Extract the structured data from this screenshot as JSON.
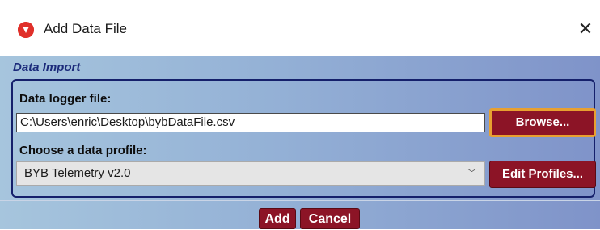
{
  "window": {
    "title": "Add Data File",
    "icon": "app-logo-icon",
    "close_glyph": "✕"
  },
  "section": {
    "title": "Data Import"
  },
  "logger": {
    "label": "Data logger file:",
    "path": "C:\\Users\\enric\\Desktop\\bybDataFile.csv",
    "browse_label": "Browse..."
  },
  "profile": {
    "label": "Choose a data profile:",
    "selected": "BYB Telemetry v2.0",
    "edit_label": "Edit Profiles..."
  },
  "actions": {
    "add_label": "Add",
    "cancel_label": "Cancel"
  },
  "colors": {
    "accent_red": "#8c1426",
    "focus_border": "#e8a030",
    "header_text": "#1b2a7a"
  }
}
